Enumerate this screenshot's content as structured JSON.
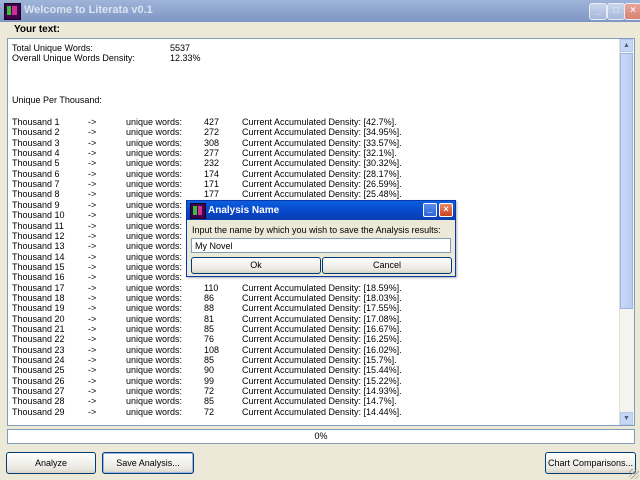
{
  "window": {
    "title": "Welcome to Literata v0.1"
  },
  "main": {
    "your_text_label": "Your text:",
    "stats": {
      "total_label": "Total Unique Words:",
      "total_value": "5537",
      "density_label": "Overall Unique Words Density:",
      "density_value": "12.33%",
      "per_thousand_label": "Unique Per Thousand:"
    },
    "rows": [
      {
        "thousand": "Thousand 1",
        "arrow": "->",
        "label": "unique words:",
        "value": "427",
        "density": "Current Accumulated Density: [42.7%]."
      },
      {
        "thousand": "Thousand 2",
        "arrow": "->",
        "label": "unique words:",
        "value": "272",
        "density": "Current Accumulated Density: [34.95%]."
      },
      {
        "thousand": "Thousand 3",
        "arrow": "->",
        "label": "unique words:",
        "value": "308",
        "density": "Current Accumulated Density: [33.57%]."
      },
      {
        "thousand": "Thousand 4",
        "arrow": "->",
        "label": "unique words:",
        "value": "277",
        "density": "Current Accumulated Density: [32.1%]."
      },
      {
        "thousand": "Thousand 5",
        "arrow": "->",
        "label": "unique words:",
        "value": "232",
        "density": "Current Accumulated Density: [30.32%]."
      },
      {
        "thousand": "Thousand 6",
        "arrow": "->",
        "label": "unique words:",
        "value": "174",
        "density": "Current Accumulated Density: [28.17%]."
      },
      {
        "thousand": "Thousand 7",
        "arrow": "->",
        "label": "unique words:",
        "value": "171",
        "density": "Current Accumulated Density: [26.59%]."
      },
      {
        "thousand": "Thousand 8",
        "arrow": "->",
        "label": "unique words:",
        "value": "177",
        "density": "Current Accumulated Density: [25.48%]."
      },
      {
        "thousand": "Thousand 9",
        "arrow": "->",
        "label": "unique words:",
        "value": "",
        "density": ""
      },
      {
        "thousand": "Thousand 10",
        "arrow": "->",
        "label": "unique words:",
        "value": "",
        "density": ""
      },
      {
        "thousand": "Thousand 11",
        "arrow": "->",
        "label": "unique words:",
        "value": "",
        "density": ""
      },
      {
        "thousand": "Thousand 12",
        "arrow": "->",
        "label": "unique words:",
        "value": "",
        "density": ""
      },
      {
        "thousand": "Thousand 13",
        "arrow": "->",
        "label": "unique words:",
        "value": "",
        "density": ""
      },
      {
        "thousand": "Thousand 14",
        "arrow": "->",
        "label": "unique words:",
        "value": "",
        "density": ""
      },
      {
        "thousand": "Thousand 15",
        "arrow": "->",
        "label": "unique words:",
        "value": "",
        "density": ""
      },
      {
        "thousand": "Thousand 16",
        "arrow": "->",
        "label": "unique words:",
        "value": "",
        "density": ""
      },
      {
        "thousand": "Thousand 17",
        "arrow": "->",
        "label": "unique words:",
        "value": "110",
        "density": "Current Accumulated Density: [18.59%]."
      },
      {
        "thousand": "Thousand 18",
        "arrow": "->",
        "label": "unique words:",
        "value": "86",
        "density": "Current Accumulated Density: [18.03%]."
      },
      {
        "thousand": "Thousand 19",
        "arrow": "->",
        "label": "unique words:",
        "value": "88",
        "density": "Current Accumulated Density: [17.55%]."
      },
      {
        "thousand": "Thousand 20",
        "arrow": "->",
        "label": "unique words:",
        "value": "81",
        "density": "Current Accumulated Density: [17.08%]."
      },
      {
        "thousand": "Thousand 21",
        "arrow": "->",
        "label": "unique words:",
        "value": "85",
        "density": "Current Accumulated Density: [16.67%]."
      },
      {
        "thousand": "Thousand 22",
        "arrow": "->",
        "label": "unique words:",
        "value": "76",
        "density": "Current Accumulated Density: [16.25%]."
      },
      {
        "thousand": "Thousand 23",
        "arrow": "->",
        "label": "unique words:",
        "value": "108",
        "density": "Current Accumulated Density: [16.02%]."
      },
      {
        "thousand": "Thousand 24",
        "arrow": "->",
        "label": "unique words:",
        "value": "85",
        "density": "Current Accumulated Density: [15.7%]."
      },
      {
        "thousand": "Thousand 25",
        "arrow": "->",
        "label": "unique words:",
        "value": "90",
        "density": "Current Accumulated Density: [15.44%]."
      },
      {
        "thousand": "Thousand 26",
        "arrow": "->",
        "label": "unique words:",
        "value": "99",
        "density": "Current Accumulated Density: [15.22%]."
      },
      {
        "thousand": "Thousand 27",
        "arrow": "->",
        "label": "unique words:",
        "value": "72",
        "density": "Current Accumulated Density: [14.93%]."
      },
      {
        "thousand": "Thousand 28",
        "arrow": "->",
        "label": "unique words:",
        "value": "85",
        "density": "Current Accumulated Density: [14.7%]."
      },
      {
        "thousand": "Thousand 29",
        "arrow": "->",
        "label": "unique words:",
        "value": "72",
        "density": "Current Accumulated Density: [14.44%]."
      }
    ]
  },
  "progress": {
    "text": "0%",
    "value": 0
  },
  "buttons": {
    "analyze": "Analyze",
    "save": "Save Analysis...",
    "chart": "Chart Comparisons..."
  },
  "dialog": {
    "title": "Analysis Name",
    "message": "Input the name by which you wish to save the Analysis results:",
    "input_value": "My Novel",
    "ok": "Ok",
    "cancel": "Cancel"
  },
  "icons": {
    "app": "literata-app-icon",
    "minimize": "minimize-icon",
    "maximize": "maximize-icon",
    "close": "close-icon"
  }
}
